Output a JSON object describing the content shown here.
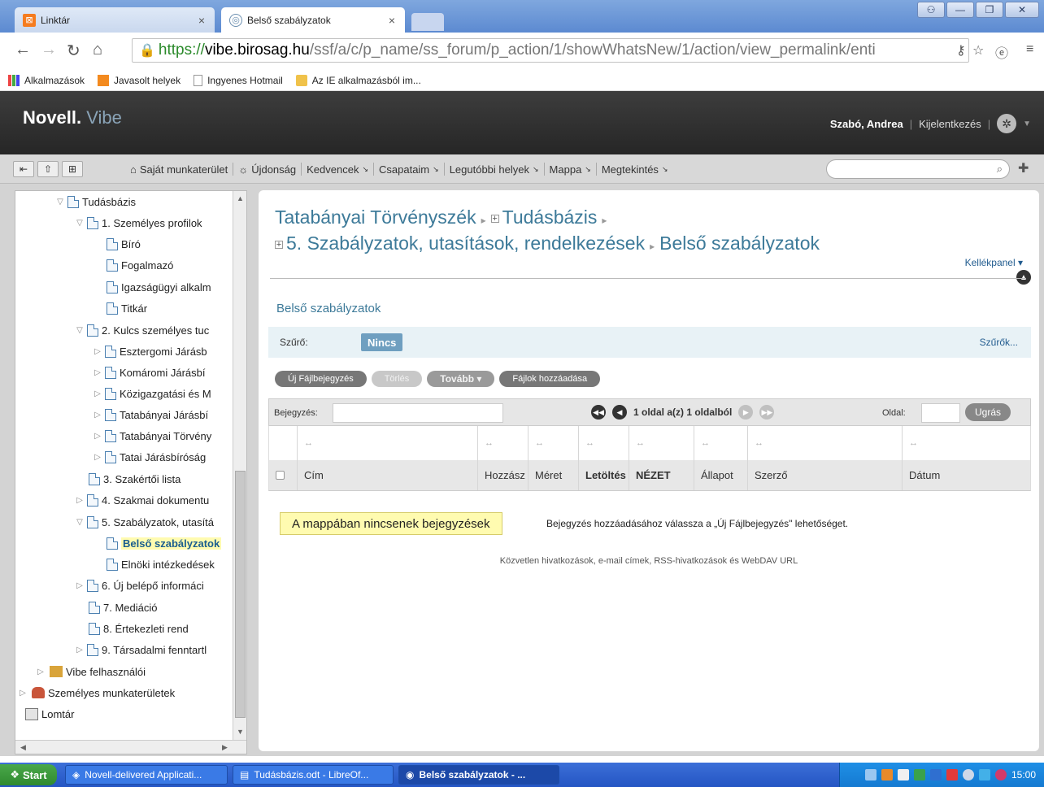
{
  "browser": {
    "tabs": [
      {
        "title": "Linktár",
        "close": "×"
      },
      {
        "title": "Belső szabályzatok",
        "close": "×"
      }
    ],
    "url": {
      "scheme": "https://",
      "host": "vibe.birosag.hu",
      "path": "/ssf/a/c/p_name/ss_forum/p_action/1/showWhatsNew/1/action/view_permalink/enti"
    },
    "bookmarks": [
      "Alkalmazások",
      "Javasolt helyek",
      "Ingyenes Hotmail",
      "Az IE alkalmazásból im..."
    ]
  },
  "header": {
    "logo_novell": "Novell.",
    "logo_vibe": "Vibe",
    "user_name": "Szabó, Andrea",
    "logout": "Kijelentkezés",
    "separator": "|"
  },
  "toolbar": {
    "items": [
      "Saját munkaterület",
      "Újdonság",
      "Kedvencek",
      "Csapataim",
      "Legutóbbi helyek",
      "Mappa",
      "Megtekintés"
    ]
  },
  "tree": {
    "items": [
      {
        "label": "Tudásbázis"
      },
      {
        "label": "1. Személyes profilok"
      },
      {
        "label": "Bíró"
      },
      {
        "label": "Fogalmazó"
      },
      {
        "label": "Igazságügyi alkalm"
      },
      {
        "label": "Titkár"
      },
      {
        "label": "2. Kulcs személyes tuc"
      },
      {
        "label": "Esztergomi Járásb"
      },
      {
        "label": "Komáromi Járásbí"
      },
      {
        "label": "Közigazgatási és M"
      },
      {
        "label": "Tatabányai Járásbí"
      },
      {
        "label": "Tatabányai Törvény"
      },
      {
        "label": "Tatai Járásbíróság"
      },
      {
        "label": "3. Szakértői lista"
      },
      {
        "label": "4. Szakmai dokumentu"
      },
      {
        "label": "5. Szabályzatok, utasítá"
      },
      {
        "label": "Belső szabályzatok"
      },
      {
        "label": "Elnöki intézkedések"
      },
      {
        "label": "6. Új belépő informáci"
      },
      {
        "label": "7. Mediáció"
      },
      {
        "label": "8. Értekezleti rend"
      },
      {
        "label": "9. Társadalmi fenntartl"
      },
      {
        "label": "Vibe felhasználói"
      },
      {
        "label": "Személyes munkaterületek"
      },
      {
        "label": "Lomtár"
      }
    ]
  },
  "content": {
    "breadcrumb": {
      "part1": "Tatabányai Törvényszék",
      "part2": "Tudásbázis",
      "part3": "5. Szabályzatok, utasítások, rendelkezések",
      "part4": "Belső szabályzatok"
    },
    "kellekpanel": "Kellékpanel",
    "subtitle": "Belső szabályzatok",
    "filter": {
      "label": "Szűrő:",
      "value": "Nincs",
      "link": "Szűrők..."
    },
    "actions": {
      "new": "Új Fájlbejegyzés",
      "delete": "Törlés",
      "more": "Tovább",
      "add_files": "Fájlok hozzáadása"
    },
    "pager": {
      "entry_label": "Bejegyzés:",
      "page_info": "1 oldal a(z) 1 oldalból",
      "page_label": "Oldal:",
      "go": "Ugrás"
    },
    "columns": {
      "resize": "↔",
      "title": "Cím",
      "contrib": "Hozzász",
      "size": "Méret",
      "download": "Letöltés",
      "view": "NÉZET",
      "status": "Állapot",
      "author": "Szerző",
      "date": "Dátum"
    },
    "empty_badge": "A mappában nincsenek bejegyzések",
    "empty_text": "Bejegyzés hozzáadásához válassza a „Új Fájlbejegyzés\" lehetőséget.",
    "footer_links": "Közvetlen hivatkozások, e-mail címek, RSS-hivatkozások és WebDAV URL"
  },
  "taskbar": {
    "start": "Start",
    "items": [
      "Novell-delivered Applicati...",
      "Tudásbázis.odt - LibreOf...",
      "Belső szabályzatok - ..."
    ],
    "clock": "15:00"
  }
}
